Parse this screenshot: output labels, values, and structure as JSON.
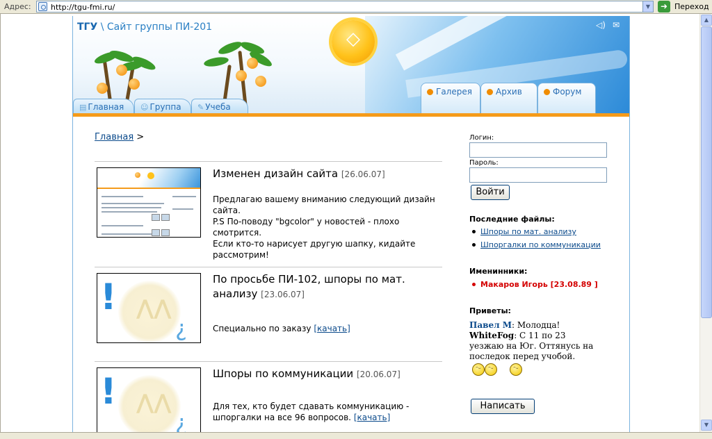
{
  "browser": {
    "address_label": "Адрес:",
    "url": "http://tgu-fmi.ru/",
    "go_label": "Переход"
  },
  "header": {
    "brand": "ТГУ",
    "separator": " \\ ",
    "subtitle": "Сайт группы ПИ-201",
    "left_tabs": [
      "Главная",
      "Группа",
      "Учеба"
    ],
    "right_tabs": [
      "Галерея",
      "Архив",
      "Форум"
    ]
  },
  "breadcrumb": {
    "home": "Главная",
    "sep": " >"
  },
  "news": [
    {
      "title": "Изменен дизайн сайта",
      "date": "[26.06.07]",
      "lines": [
        "Предлагаю вашему вниманию следующий дизайн",
        "сайта.",
        "P.S По-поводу \"bgcolor\" у новостей - плохо смотрится.",
        "Если кто-то нарисует другую шапку, кидайте",
        "рассмотрим!"
      ]
    },
    {
      "title": "По просьбе ПИ-102, шпоры по мат. анализу",
      "date": "[23.06.07]",
      "text": "Специально по заказу",
      "link": "[качать]"
    },
    {
      "title": "Шпоры по коммуникации",
      "date": "[20.06.07]",
      "text_line1": "Для тех, кто будет сдавать коммуникацию -",
      "text_line2": "шпоргалки на все 96 вопросов.",
      "link": "[качать]"
    }
  ],
  "sidebar": {
    "login_label": "Логин:",
    "password_label": "Пароль:",
    "login_button": "Войти",
    "files_heading": "Последние файлы:",
    "files": [
      "Шпоры по мат. анализу",
      "Шпоргалки по коммуникации"
    ],
    "birthdays_heading": "Именинники:",
    "birthday": "Макаров Игорь [23.08.89 ]",
    "greetings_heading": "Приветы:",
    "greetings": [
      {
        "name": "Павел М",
        "text": ": Молодца!"
      },
      {
        "name": "WhiteFog",
        "text": ": С 11 по 23 уезжаю на Юг. Оттянусь на последок перед учобой."
      }
    ],
    "write_button": "Написать"
  },
  "colors": {
    "accent_orange": "#f59b1a",
    "link_blue": "#0b4a8b",
    "title_blue": "#2a7fc4",
    "birthday_red": "#d40000"
  },
  "icons": {
    "page": "document-icon",
    "sound": "speaker-icon",
    "mail": "envelope-icon"
  }
}
